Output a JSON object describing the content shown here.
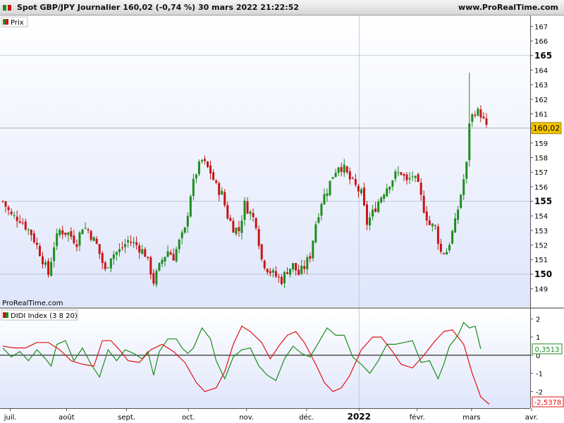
{
  "header": {
    "title": "Spot GBP/JPY Journalier 160,02 (-0,74 %) 30 mars 2022 21:22:52",
    "site": "www.ProRealTime.com"
  },
  "colors": {
    "up": "#1e8c1e",
    "down": "#c81414",
    "panel_top": "#ffffff",
    "panel_bottom": "#dfe6fb",
    "last_price_bg": "#f5c400"
  },
  "chart_data": [
    {
      "type": "candlestick",
      "legend": "Prix",
      "watermark": "ProRealTime.com",
      "ylim": [
        148.4,
        167.6
      ],
      "y_ticks": [
        149,
        150,
        151,
        152,
        153,
        154,
        155,
        156,
        157,
        158,
        159,
        160,
        161,
        162,
        163,
        164,
        165,
        166,
        167
      ],
      "y_bold_ticks": [
        150,
        155,
        165
      ],
      "last_price": 160.02,
      "last_price_label": "160,02",
      "x_labels": [
        "juil.",
        "août",
        "sept.",
        "oct.",
        "nov.",
        "déc.",
        "2022",
        "févr.",
        "mars",
        "avr."
      ],
      "x_bold_labels": [
        "2022"
      ],
      "anchors": [
        [
          0,
          155.0
        ],
        [
          3,
          154.0
        ],
        [
          6,
          153.8
        ],
        [
          10,
          152.8
        ],
        [
          13,
          151.5
        ],
        [
          16,
          150.0
        ],
        [
          18,
          152.0
        ],
        [
          20,
          153.0
        ],
        [
          23,
          152.8
        ],
        [
          26,
          152.2
        ],
        [
          28,
          153.3
        ],
        [
          30,
          153.0
        ],
        [
          33,
          152.0
        ],
        [
          36,
          150.2
        ],
        [
          38,
          151.3
        ],
        [
          41,
          151.6
        ],
        [
          44,
          152.3
        ],
        [
          47,
          152.0
        ],
        [
          50,
          151.4
        ],
        [
          52,
          150.2
        ],
        [
          53,
          149.5
        ],
        [
          56,
          151.0
        ],
        [
          58,
          151.6
        ],
        [
          60,
          151.2
        ],
        [
          62,
          152.2
        ],
        [
          64,
          153.0
        ],
        [
          66,
          155.5
        ],
        [
          68,
          157.0
        ],
        [
          70,
          157.8
        ],
        [
          73,
          157.0
        ],
        [
          75,
          156.0
        ],
        [
          77,
          155.5
        ],
        [
          79,
          154.0
        ],
        [
          81,
          153.2
        ],
        [
          83,
          153.0
        ],
        [
          85,
          154.8
        ],
        [
          87,
          154.2
        ],
        [
          89,
          153.5
        ],
        [
          91,
          151.0
        ],
        [
          93,
          150.4
        ],
        [
          95,
          150.0
        ],
        [
          98,
          149.6
        ],
        [
          100,
          150.3
        ],
        [
          102,
          150.6
        ],
        [
          104,
          150.0
        ],
        [
          106,
          150.5
        ],
        [
          108,
          151.3
        ],
        [
          110,
          153.5
        ],
        [
          112,
          155.0
        ],
        [
          114,
          155.8
        ],
        [
          116,
          156.8
        ],
        [
          118,
          157.5
        ],
        [
          120,
          157.2
        ],
        [
          122,
          156.5
        ],
        [
          124,
          156.0
        ],
        [
          126,
          155.5
        ],
        [
          128,
          153.5
        ],
        [
          130,
          154.2
        ],
        [
          132,
          155.0
        ],
        [
          134,
          155.7
        ],
        [
          136,
          156.3
        ],
        [
          138,
          156.8
        ],
        [
          140,
          157.0
        ],
        [
          142,
          156.3
        ],
        [
          144,
          156.8
        ],
        [
          146,
          156.0
        ],
        [
          148,
          154.5
        ],
        [
          150,
          153.4
        ],
        [
          152,
          153.2
        ],
        [
          154,
          151.5
        ],
        [
          156,
          151.6
        ],
        [
          157,
          152.2
        ],
        [
          159,
          153.5
        ],
        [
          161,
          155.5
        ],
        [
          163,
          157.5
        ],
        [
          164,
          160.5
        ],
        [
          166,
          161.2
        ],
        [
          168,
          161.0
        ],
        [
          170,
          160.0
        ]
      ],
      "bars": 171
    },
    {
      "type": "line",
      "legend": "DIDI Index (3 8 20)",
      "ylim": [
        -2.8,
        2.4
      ],
      "y_ticks": [
        2,
        1,
        0,
        -1,
        -2
      ],
      "zero_line": 0,
      "series": [
        {
          "name": "Green",
          "color": "#1e8c1e",
          "last_label": "0,3513",
          "anchors": [
            [
              0,
              0.4
            ],
            [
              3,
              -0.1
            ],
            [
              6,
              0.2
            ],
            [
              9,
              -0.3
            ],
            [
              12,
              0.3
            ],
            [
              15,
              -0.2
            ],
            [
              17,
              -0.6
            ],
            [
              19,
              0.6
            ],
            [
              22,
              0.8
            ],
            [
              25,
              -0.3
            ],
            [
              28,
              0.4
            ],
            [
              31,
              -0.5
            ],
            [
              34,
              -1.2
            ],
            [
              37,
              0.3
            ],
            [
              40,
              -0.3
            ],
            [
              43,
              0.3
            ],
            [
              46,
              0.1
            ],
            [
              49,
              -0.2
            ],
            [
              51,
              0.2
            ],
            [
              53,
              -1.1
            ],
            [
              55,
              0.2
            ],
            [
              58,
              0.9
            ],
            [
              61,
              0.9
            ],
            [
              63,
              0.4
            ],
            [
              65,
              0.1
            ],
            [
              67,
              0.4
            ],
            [
              70,
              1.5
            ],
            [
              73,
              0.9
            ],
            [
              75,
              -0.3
            ],
            [
              78,
              -1.3
            ],
            [
              81,
              -0.1
            ],
            [
              84,
              0.3
            ],
            [
              87,
              0.4
            ],
            [
              90,
              -0.6
            ],
            [
              93,
              -1.1
            ],
            [
              96,
              -1.4
            ],
            [
              99,
              -0.2
            ],
            [
              102,
              0.5
            ],
            [
              105,
              0.1
            ],
            [
              108,
              -0.1
            ],
            [
              111,
              0.7
            ],
            [
              114,
              1.5
            ],
            [
              117,
              1.1
            ],
            [
              120,
              1.1
            ],
            [
              123,
              -0.1
            ],
            [
              126,
              -0.5
            ],
            [
              129,
              -1.0
            ],
            [
              132,
              -0.3
            ],
            [
              135,
              0.6
            ],
            [
              138,
              0.6
            ],
            [
              141,
              0.7
            ],
            [
              144,
              0.8
            ],
            [
              147,
              -0.4
            ],
            [
              150,
              -0.3
            ],
            [
              153,
              -1.3
            ],
            [
              155,
              -0.5
            ],
            [
              157,
              0.5
            ],
            [
              160,
              1.1
            ],
            [
              162,
              1.8
            ],
            [
              164,
              1.5
            ],
            [
              166,
              1.6
            ],
            [
              168,
              0.35
            ]
          ]
        },
        {
          "name": "Red",
          "color": "#e01414",
          "last_label": "-2,5378",
          "anchors": [
            [
              0,
              0.5
            ],
            [
              4,
              0.4
            ],
            [
              8,
              0.4
            ],
            [
              12,
              0.7
            ],
            [
              16,
              0.7
            ],
            [
              20,
              0.3
            ],
            [
              24,
              -0.3
            ],
            [
              28,
              -0.5
            ],
            [
              32,
              -0.6
            ],
            [
              35,
              0.8
            ],
            [
              38,
              0.8
            ],
            [
              41,
              0.3
            ],
            [
              44,
              -0.3
            ],
            [
              48,
              -0.4
            ],
            [
              52,
              0.3
            ],
            [
              56,
              0.6
            ],
            [
              60,
              0.2
            ],
            [
              64,
              -0.4
            ],
            [
              68,
              -1.5
            ],
            [
              71,
              -2.0
            ],
            [
              75,
              -1.8
            ],
            [
              78,
              -0.9
            ],
            [
              81,
              0.6
            ],
            [
              84,
              1.6
            ],
            [
              87,
              1.3
            ],
            [
              91,
              0.7
            ],
            [
              94,
              -0.2
            ],
            [
              97,
              0.5
            ],
            [
              100,
              1.1
            ],
            [
              103,
              1.3
            ],
            [
              106,
              0.7
            ],
            [
              110,
              -0.5
            ],
            [
              113,
              -1.5
            ],
            [
              116,
              -2.0
            ],
            [
              119,
              -1.8
            ],
            [
              122,
              -1.1
            ],
            [
              126,
              0.3
            ],
            [
              130,
              1.0
            ],
            [
              133,
              1.0
            ],
            [
              137,
              0.2
            ],
            [
              140,
              -0.5
            ],
            [
              144,
              -0.7
            ],
            [
              148,
              0.0
            ],
            [
              152,
              0.8
            ],
            [
              155,
              1.3
            ],
            [
              158,
              1.4
            ],
            [
              162,
              0.6
            ],
            [
              165,
              -1.0
            ],
            [
              168,
              -2.3
            ],
            [
              171,
              -2.7
            ]
          ]
        }
      ]
    }
  ]
}
